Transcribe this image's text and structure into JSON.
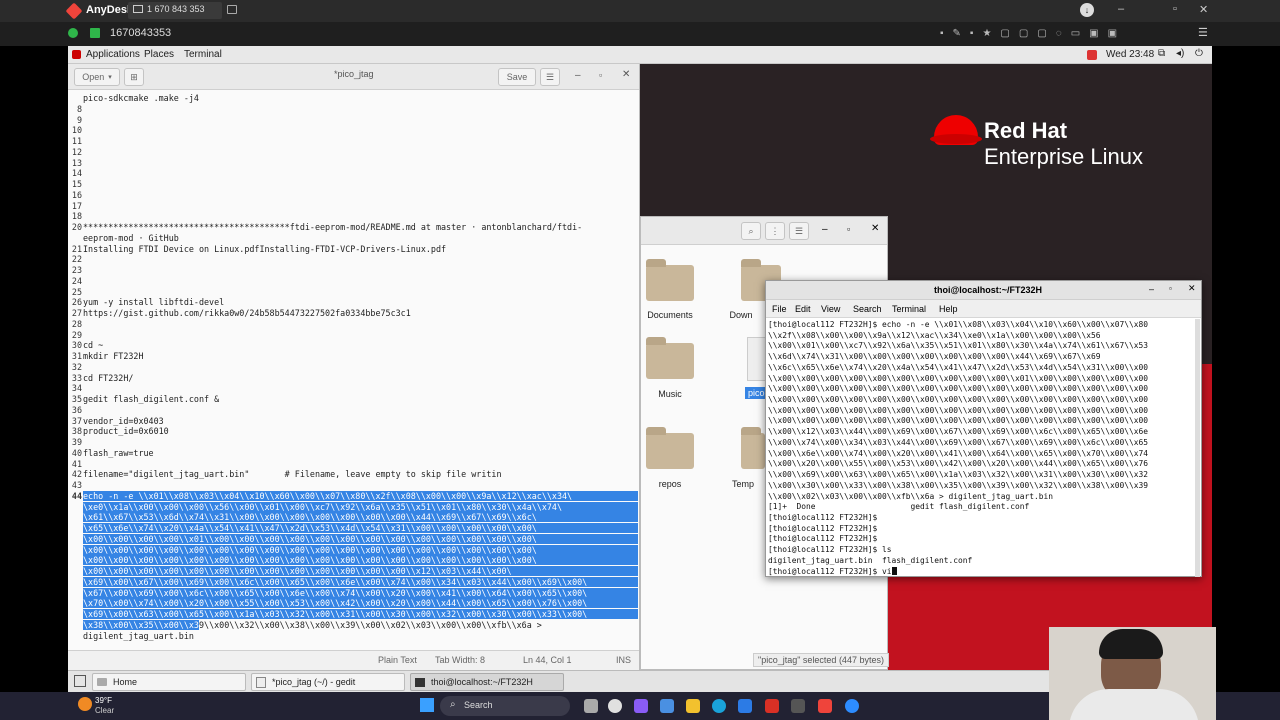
{
  "anydesk": {
    "app_name": "AnyDesk",
    "tab_id": "1 670 843 353",
    "session_id": "1670843353"
  },
  "gnome": {
    "applications": "Applications",
    "places": "Places",
    "terminal": "Terminal",
    "clock": "Wed 23:48"
  },
  "gedit": {
    "open_label": "Open",
    "title": "*pico_jtag",
    "save_label": "Save",
    "lines": [
      {
        "n": "",
        "t": "pico-sdkcmake .make -j4"
      },
      {
        "n": "8",
        "t": ""
      },
      {
        "n": "9",
        "t": ""
      },
      {
        "n": "10",
        "t": ""
      },
      {
        "n": "11",
        "t": ""
      },
      {
        "n": "12",
        "t": ""
      },
      {
        "n": "13",
        "t": ""
      },
      {
        "n": "14",
        "t": ""
      },
      {
        "n": "15",
        "t": ""
      },
      {
        "n": "16",
        "t": ""
      },
      {
        "n": "17",
        "t": ""
      },
      {
        "n": "18",
        "t": ""
      },
      {
        "n": "20",
        "t": "*****************************************ftdi-eeprom-mod/README.md at master · antonblanchard/ftdi-"
      },
      {
        "n": "",
        "t": "eeprom-mod · GitHub"
      },
      {
        "n": "21",
        "t": "Installing FTDI Device on Linux.pdfInstalling-FTDI-VCP-Drivers-Linux.pdf"
      },
      {
        "n": "22",
        "t": ""
      },
      {
        "n": "23",
        "t": ""
      },
      {
        "n": "24",
        "t": ""
      },
      {
        "n": "25",
        "t": ""
      },
      {
        "n": "26",
        "t": "yum -y install libftdi-devel"
      },
      {
        "n": "27",
        "t": "https://gist.github.com/rikka0w0/24b58b54473227502fa0334bbe75c3c1"
      },
      {
        "n": "28",
        "t": ""
      },
      {
        "n": "29",
        "t": ""
      },
      {
        "n": "30",
        "t": "cd ~"
      },
      {
        "n": "31",
        "t": "mkdir FT232H"
      },
      {
        "n": "32",
        "t": ""
      },
      {
        "n": "33",
        "t": "cd FT232H/"
      },
      {
        "n": "34",
        "t": ""
      },
      {
        "n": "35",
        "t": "gedit flash_digilent.conf &"
      },
      {
        "n": "36",
        "t": ""
      },
      {
        "n": "37",
        "t": "vendor_id=0x0403"
      },
      {
        "n": "38",
        "t": "product_id=0x6010"
      },
      {
        "n": "39",
        "t": ""
      },
      {
        "n": "40",
        "t": "flash_raw=true"
      },
      {
        "n": "41",
        "t": ""
      },
      {
        "n": "42",
        "t": "filename=\"digilent_jtag_uart.bin\"       # Filename, leave empty to skip file writin"
      },
      {
        "n": "43",
        "t": ""
      }
    ],
    "selected_lines": [
      "echo -n -e \\\\x01\\\\x08\\\\x03\\\\x04\\\\x10\\\\x60\\\\x00\\\\x07\\\\x80\\\\x2f\\\\x08\\\\x00\\\\x00\\\\x9a\\\\x12\\\\xac\\\\x34\\",
      "\\xe0\\\\x1a\\\\x00\\\\x00\\\\x00\\\\x56\\\\x00\\\\x01\\\\x00\\\\xc7\\\\x92\\\\x6a\\\\x35\\\\x51\\\\x01\\\\x80\\\\x30\\\\x4a\\\\x74\\",
      "\\x61\\\\x67\\\\x53\\\\x6d\\\\x74\\\\x31\\\\x00\\\\x00\\\\x00\\\\x00\\\\x00\\\\x00\\\\x00\\\\x44\\\\x69\\\\x67\\\\x69\\\\x6c\\",
      "\\x65\\\\x6e\\\\x74\\\\x20\\\\x4a\\\\x54\\\\x41\\\\x47\\\\x2d\\\\x53\\\\x4d\\\\x54\\\\x31\\\\x00\\\\x00\\\\x00\\\\x00\\\\x00\\",
      "\\x00\\\\x00\\\\x00\\\\x00\\\\x01\\\\x00\\\\x00\\\\x00\\\\x00\\\\x00\\\\x00\\\\x00\\\\x00\\\\x00\\\\x00\\\\x00\\\\x00\\\\x00\\",
      "\\x00\\\\x00\\\\x00\\\\x00\\\\x00\\\\x00\\\\x00\\\\x00\\\\x00\\\\x00\\\\x00\\\\x00\\\\x00\\\\x00\\\\x00\\\\x00\\\\x00\\\\x00\\",
      "\\x00\\\\x00\\\\x00\\\\x00\\\\x00\\\\x00\\\\x00\\\\x00\\\\x00\\\\x00\\\\x00\\\\x00\\\\x00\\\\x00\\\\x00\\\\x00\\\\x00\\\\x00\\",
      "\\x00\\\\x00\\\\x00\\\\x00\\\\x00\\\\x00\\\\x00\\\\x00\\\\x00\\\\x00\\\\x00\\\\x00\\\\x00\\\\x12\\\\x03\\\\x44\\\\x00\\",
      "\\x69\\\\x00\\\\x67\\\\x00\\\\x69\\\\x00\\\\x6c\\\\x00\\\\x65\\\\x00\\\\x6e\\\\x00\\\\x74\\\\x00\\\\x34\\\\x03\\\\x44\\\\x00\\\\x69\\\\x00\\",
      "\\x67\\\\x00\\\\x69\\\\x00\\\\x6c\\\\x00\\\\x65\\\\x00\\\\x6e\\\\x00\\\\x74\\\\x00\\\\x20\\\\x00\\\\x41\\\\x00\\\\x64\\\\x00\\\\x65\\\\x00\\",
      "\\x70\\\\x00\\\\x74\\\\x00\\\\x20\\\\x00\\\\x55\\\\x00\\\\x53\\\\x00\\\\x42\\\\x00\\\\x20\\\\x00\\\\x44\\\\x00\\\\x65\\\\x00\\\\x76\\\\x00\\",
      "\\x69\\\\x00\\\\x63\\\\x00\\\\x65\\\\x00\\\\x1a\\\\x03\\\\x32\\\\x00\\\\x31\\\\x00\\\\x30\\\\x00\\\\x32\\\\x00\\\\x30\\\\x00\\\\x33\\\\x00\\"
    ],
    "selected_partial": "\\x38\\\\x00\\\\x35\\\\x00\\\\x3",
    "after_selection": "9\\\\x00\\\\x32\\\\x00\\\\x38\\\\x00\\\\x39\\\\x00\\\\x02\\\\x03\\\\x00\\\\x00\\\\xfb\\\\x6a >",
    "last_line": "digilent_jtag_uart.bin",
    "current_line_number": "44",
    "status_syntax": "Plain Text",
    "status_tab": "Tab Width: 8",
    "status_pos": "Ln 44, Col 1",
    "status_mode": "INS"
  },
  "files": {
    "items": [
      "Documents",
      "Down",
      "Music",
      "pico",
      "repos",
      "Temp"
    ],
    "status": "\"pico_jtag\" selected (447 bytes)"
  },
  "brand": {
    "line1": "Red Hat",
    "line2": "Enterprise Linux"
  },
  "terminal": {
    "title": "thoi@localhost:~/FT232H",
    "menu": [
      "File",
      "Edit",
      "View",
      "Search",
      "Terminal",
      "Help"
    ],
    "lines": [
      "[thoi@local112 FT232H]$ echo -n -e \\\\x01\\\\x08\\\\x03\\\\x04\\\\x10\\\\x60\\\\x00\\\\x07\\\\x80",
      "\\\\x2f\\\\x08\\\\x00\\\\x00\\\\x9a\\\\x12\\\\xac\\\\x34\\\\xe0\\\\x1a\\\\x00\\\\x00\\\\x00\\\\x56",
      "\\\\x00\\\\x01\\\\x00\\\\xc7\\\\x92\\\\x6a\\\\x35\\\\x51\\\\x01\\\\x80\\\\x30\\\\x4a\\\\x74\\\\x61\\\\x67\\\\x53",
      "\\\\x6d\\\\x74\\\\x31\\\\x00\\\\x00\\\\x00\\\\x00\\\\x00\\\\x00\\\\x00\\\\x44\\\\x69\\\\x67\\\\x69",
      "\\\\x6c\\\\x65\\\\x6e\\\\x74\\\\x20\\\\x4a\\\\x54\\\\x41\\\\x47\\\\x2d\\\\x53\\\\x4d\\\\x54\\\\x31\\\\x00\\\\x00",
      "\\\\x00\\\\x00\\\\x00\\\\x00\\\\x00\\\\x00\\\\x00\\\\x00\\\\x00\\\\x00\\\\x01\\\\x00\\\\x00\\\\x00\\\\x00\\\\x00",
      "\\\\x00\\\\x00\\\\x00\\\\x00\\\\x00\\\\x00\\\\x00\\\\x00\\\\x00\\\\x00\\\\x00\\\\x00\\\\x00\\\\x00\\\\x00\\\\x00",
      "\\\\x00\\\\x00\\\\x00\\\\x00\\\\x00\\\\x00\\\\x00\\\\x00\\\\x00\\\\x00\\\\x00\\\\x00\\\\x00\\\\x00\\\\x00\\\\x00",
      "\\\\x00\\\\x00\\\\x00\\\\x00\\\\x00\\\\x00\\\\x00\\\\x00\\\\x00\\\\x00\\\\x00\\\\x00\\\\x00\\\\x00\\\\x00\\\\x00",
      "\\\\x00\\\\x00\\\\x00\\\\x00\\\\x00\\\\x00\\\\x00\\\\x00\\\\x00\\\\x00\\\\x00\\\\x00\\\\x00\\\\x00\\\\x00\\\\x00",
      "\\\\x00\\\\x12\\\\x03\\\\x44\\\\x00\\\\x69\\\\x00\\\\x67\\\\x00\\\\x69\\\\x00\\\\x6c\\\\x00\\\\x65\\\\x00\\\\x6e",
      "\\\\x00\\\\x74\\\\x00\\\\x34\\\\x03\\\\x44\\\\x00\\\\x69\\\\x00\\\\x67\\\\x00\\\\x69\\\\x00\\\\x6c\\\\x00\\\\x65",
      "\\\\x00\\\\x6e\\\\x00\\\\x74\\\\x00\\\\x20\\\\x00\\\\x41\\\\x00\\\\x64\\\\x00\\\\x65\\\\x00\\\\x70\\\\x00\\\\x74",
      "\\\\x00\\\\x20\\\\x00\\\\x55\\\\x00\\\\x53\\\\x00\\\\x42\\\\x00\\\\x20\\\\x00\\\\x44\\\\x00\\\\x65\\\\x00\\\\x76",
      "\\\\x00\\\\x69\\\\x00\\\\x63\\\\x00\\\\x65\\\\x00\\\\x1a\\\\x03\\\\x32\\\\x00\\\\x31\\\\x00\\\\x30\\\\x00\\\\x32",
      "\\\\x00\\\\x30\\\\x00\\\\x33\\\\x00\\\\x38\\\\x00\\\\x35\\\\x00\\\\x39\\\\x00\\\\x32\\\\x00\\\\x38\\\\x00\\\\x39",
      "\\\\x00\\\\x02\\\\x03\\\\x00\\\\x00\\\\xfb\\\\x6a > digilent_jtag_uart.bin",
      "[1]+  Done                    gedit flash_digilent.conf",
      "[thoi@local112 FT232H]$",
      "[thoi@local112 FT232H]$",
      "[thoi@local112 FT232H]$",
      "[thoi@local112 FT232H]$ ls",
      "digilent_jtag_uart.bin  flash_digilent.conf",
      "[thoi@local112 FT232H]$ vi"
    ]
  },
  "gnome_taskbar": {
    "home": "Home",
    "gedit": "*pico_jtag (~/) - gedit",
    "terminal": "thoi@localhost:~/FT232H"
  },
  "windows": {
    "temp": "39°F",
    "weather": "Clear",
    "search": "Search"
  }
}
